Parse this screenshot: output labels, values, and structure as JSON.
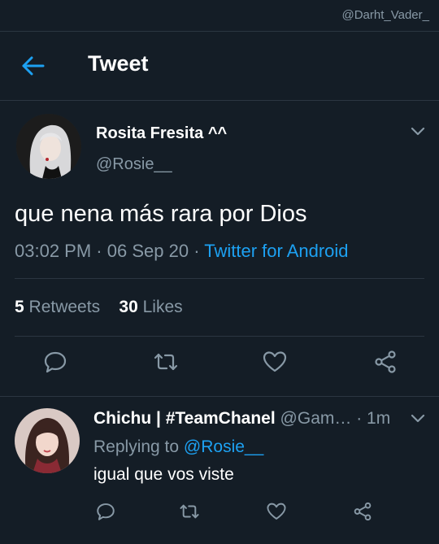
{
  "watermark": "@Darht_Vader_",
  "header": {
    "title": "Tweet",
    "back_icon": "arrow-left-icon"
  },
  "colors": {
    "background": "#141d26",
    "accent": "#1da1f2",
    "muted": "#8899a6",
    "divider": "#2b3641"
  },
  "tweet": {
    "author_name": "Rosita Fresita ^^",
    "author_handle": "@Rosie__",
    "text": "que nena más rara por Dios",
    "time": "03:02 PM",
    "date": "06 Sep 20",
    "source": "Twitter for Android",
    "retweets_count": "5",
    "retweets_label": "Retweets",
    "likes_count": "30",
    "likes_label": "Likes",
    "action_icons": [
      "comment-icon",
      "retweet-icon",
      "heart-icon",
      "share-icon"
    ]
  },
  "reply": {
    "author_name": "Chichu | #TeamChanel",
    "author_handle": "@Gam…",
    "time": "1m",
    "replying_to_label": "Replying to",
    "replying_to_handle": "@Rosie__",
    "text": "igual que vos viste",
    "action_icons": [
      "comment-icon",
      "retweet-icon",
      "heart-icon",
      "share-icon"
    ]
  }
}
